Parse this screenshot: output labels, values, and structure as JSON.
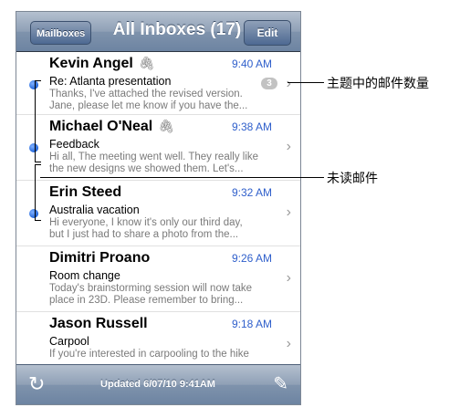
{
  "nav": {
    "back_label": "Mailboxes",
    "title": "All Inboxes (17)",
    "edit_label": "Edit"
  },
  "emails": [
    {
      "sender": "Kevin Angel",
      "time": "9:40 AM",
      "subject": "Re: Atlanta presentation",
      "preview_line1": "Thanks, I've attached the revised version.",
      "preview_line2": "Jane, please let me know if you have the...",
      "unread": true,
      "attachment": true,
      "thread_count": "3"
    },
    {
      "sender": "Michael O'Neal",
      "time": "9:38 AM",
      "subject": "Feedback",
      "preview_line1": "Hi all, The meeting went well. They really like",
      "preview_line2": "the new designs we showed them. Let's...",
      "unread": true,
      "attachment": true
    },
    {
      "sender": "Erin Steed",
      "time": "9:32 AM",
      "subject": "Australia vacation",
      "preview_line1": "Hi everyone, I know it's only our third day,",
      "preview_line2": "but I just had to share a photo from the...",
      "unread": true,
      "attachment": false
    },
    {
      "sender": "Dimitri Proano",
      "time": "9:26 AM",
      "subject": "Room change",
      "preview_line1": "Today's brainstorming session will now take",
      "preview_line2": "place in 23D. Please remember to bring...",
      "unread": false,
      "attachment": false
    },
    {
      "sender": "Jason Russell",
      "time": "9:18 AM",
      "subject": "Carpool",
      "preview_line1": "If you're interested in carpooling to the hike",
      "preview_line2": "",
      "unread": false,
      "attachment": false
    }
  ],
  "toolbar": {
    "updated_text": "Updated 6/07/10 9:41AM",
    "refresh_icon": "refresh-icon",
    "compose_icon": "compose-icon"
  },
  "annotations": {
    "thread_count_label": "主题中的邮件数量",
    "unread_label": "未读邮件"
  },
  "colors": {
    "accent": "#2f5fcb",
    "unread_dot": "#1e63d8",
    "navbar": "#7f93ac"
  }
}
